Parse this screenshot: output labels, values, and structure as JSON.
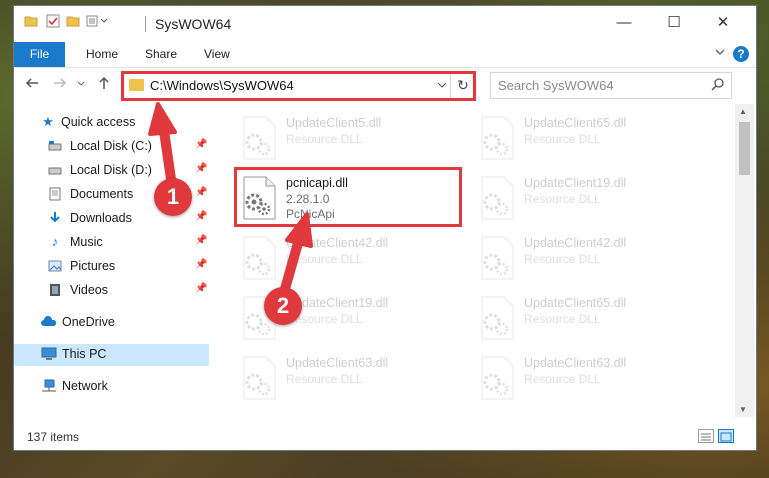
{
  "window": {
    "title": "SysWOW64",
    "controls": {
      "minimize": "—",
      "maximize": "☐",
      "close": "✕"
    }
  },
  "ribbon": {
    "file_tab": "File",
    "tabs": [
      "Home",
      "Share",
      "View"
    ],
    "expand_icon": "chevron-down-icon",
    "help": "?"
  },
  "address_bar": {
    "path": "C:\\Windows\\SysWOW64",
    "refresh_icon": "↻"
  },
  "search": {
    "placeholder": "Search SysWOW64"
  },
  "sidebar": {
    "items": [
      {
        "label": "Quick access",
        "icon": "star-icon",
        "pinned": false
      },
      {
        "label": "Local Disk (C:)",
        "icon": "drive-icon",
        "pinned": true
      },
      {
        "label": "Local Disk (D:)",
        "icon": "drive-icon",
        "pinned": true
      },
      {
        "label": "Documents",
        "icon": "documents-icon",
        "pinned": true
      },
      {
        "label": "Downloads",
        "icon": "download-icon",
        "pinned": true
      },
      {
        "label": "Music",
        "icon": "music-icon",
        "pinned": true
      },
      {
        "label": "Pictures",
        "icon": "pictures-icon",
        "pinned": true
      },
      {
        "label": "Videos",
        "icon": "videos-icon",
        "pinned": true
      },
      {
        "label": "OneDrive",
        "icon": "cloud-icon",
        "pinned": false
      },
      {
        "label": "This PC",
        "icon": "computer-icon",
        "pinned": false,
        "selected": true
      },
      {
        "label": "Network",
        "icon": "network-icon",
        "pinned": false
      }
    ]
  },
  "files": [
    {
      "name": "UpdateClient5.dll",
      "lines": [
        "Resource DLL"
      ],
      "faded": true
    },
    {
      "name": "UpdateClient65.dll",
      "lines": [
        "Resource DLL"
      ],
      "faded": true
    },
    {
      "name": "pcnicapi.dll",
      "lines": [
        "2.28.1.0",
        "PcNicApi"
      ],
      "faded": false,
      "highlighted": true
    },
    {
      "name": "UpdateClient19.dll",
      "lines": [
        "Resource DLL"
      ],
      "faded": true
    },
    {
      "name": "UpdateClient42.dll",
      "lines": [
        "Resource DLL"
      ],
      "faded": true
    },
    {
      "name": "UpdateClient42.dll",
      "lines": [
        "Resource DLL"
      ],
      "faded": true
    },
    {
      "name": "UpdateClient19.dll",
      "lines": [
        "Resource DLL"
      ],
      "faded": true
    },
    {
      "name": "UpdateClient65.dll",
      "lines": [
        "Resource DLL"
      ],
      "faded": true
    },
    {
      "name": "UpdateClient63.dll",
      "lines": [
        "Resource DLL"
      ],
      "faded": true
    },
    {
      "name": "UpdateClient63.dll",
      "lines": [
        "Resource DLL"
      ],
      "faded": true
    }
  ],
  "status_bar": {
    "item_count": "137 items"
  },
  "annotations": {
    "step1": "1",
    "step2": "2",
    "color": "#e0393d"
  },
  "colors": {
    "accent": "#1979ca",
    "selection": "#cce8ff"
  }
}
